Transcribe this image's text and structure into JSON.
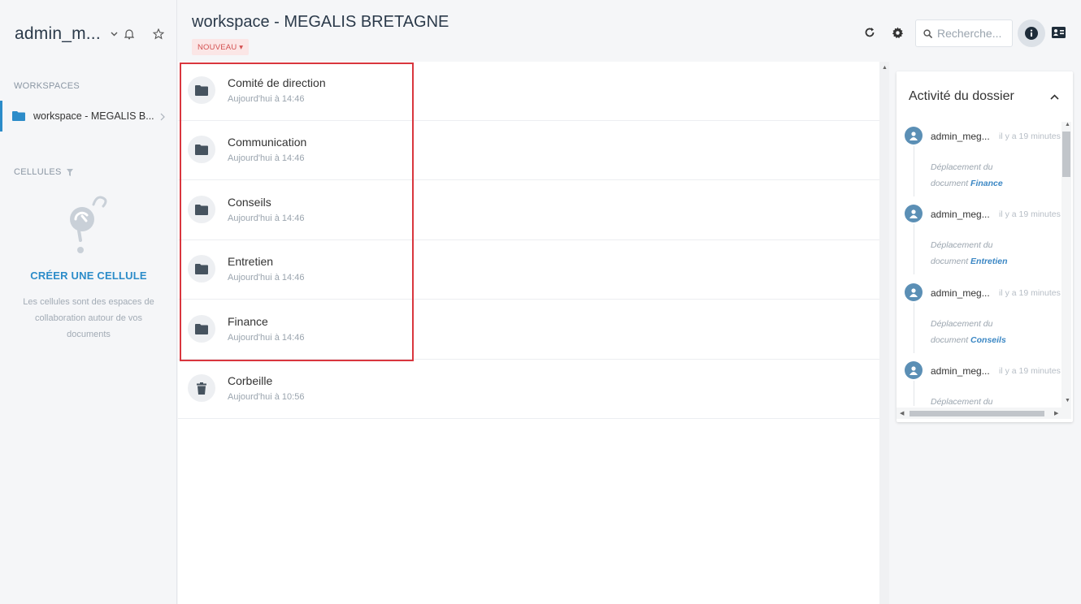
{
  "sidebar": {
    "user_name": "admin_m...",
    "workspaces_label": "WORKSPACES",
    "workspace_item": "workspace - MEGALIS B...",
    "cells_label": "CELLULES",
    "create_cell": "CRÉER UNE CELLULE",
    "cells_description": "Les cellules sont des espaces de collaboration autour de vos documents"
  },
  "header": {
    "title": "workspace - MEGALIS BRETAGNE",
    "new_button": "NOUVEAU ▾",
    "search_placeholder": "Recherche..."
  },
  "files": [
    {
      "name": "Comité de direction",
      "date": "Aujourd'hui à 14:46",
      "icon": "folder-icon"
    },
    {
      "name": "Communication",
      "date": "Aujourd'hui à 14:46",
      "icon": "folder-icon"
    },
    {
      "name": "Conseils",
      "date": "Aujourd'hui à 14:46",
      "icon": "folder-icon"
    },
    {
      "name": "Entretien",
      "date": "Aujourd'hui à 14:46",
      "icon": "folder-icon"
    },
    {
      "name": "Finance",
      "date": "Aujourd'hui à 14:46",
      "icon": "folder-icon"
    },
    {
      "name": "Corbeille",
      "date": "Aujourd'hui à 10:56",
      "icon": "trash-icon"
    }
  ],
  "activity": {
    "title": "Activité du dossier",
    "items": [
      {
        "user": "admin_meg...",
        "time": "il y a 19 minutes",
        "action": "Déplacement du",
        "target_prefix": "document",
        "target": "Finance"
      },
      {
        "user": "admin_meg...",
        "time": "il y a 19 minutes",
        "action": "Déplacement du",
        "target_prefix": "document",
        "target": "Entretien"
      },
      {
        "user": "admin_meg...",
        "time": "il y a 19 minutes",
        "action": "Déplacement du",
        "target_prefix": "document",
        "target": "Conseils"
      },
      {
        "user": "admin_meg...",
        "time": "il y a 19 minutes",
        "action": "Déplacement du",
        "target_prefix": "",
        "target": ""
      }
    ]
  },
  "colors": {
    "accent": "#2c8cc9",
    "highlight_border": "#d9363e",
    "new_button_bg": "#fbe6e6",
    "new_button_text": "#d35050"
  }
}
